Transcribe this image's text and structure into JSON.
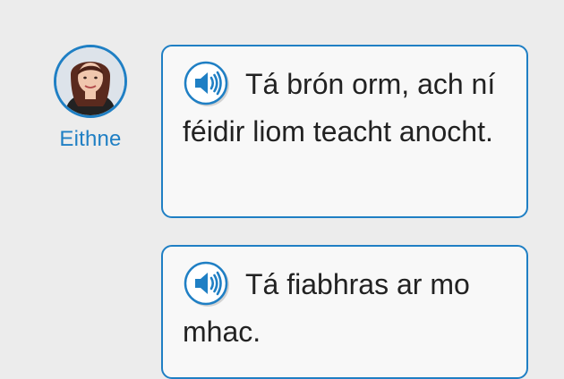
{
  "speaker": {
    "name": "Eithne"
  },
  "messages": [
    {
      "text": "Tá brón orm, ach ní féidir liom teacht anocht."
    },
    {
      "text": "Tá fiabhras ar mo mhac."
    }
  ],
  "icons": {
    "audio": "speaker-audio-icon"
  },
  "colors": {
    "accent": "#1f7fc4",
    "background": "#ececec",
    "bubble": "#f8f8f8",
    "text": "#222222"
  }
}
